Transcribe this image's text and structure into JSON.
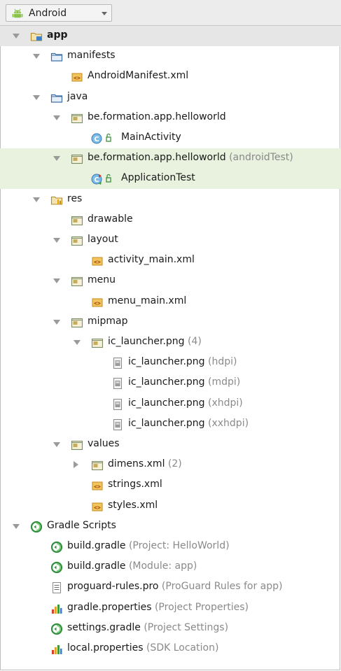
{
  "toolbar": {
    "view_selector": "Android"
  },
  "tree": [
    {
      "id": "app",
      "label": "app",
      "suffix": "",
      "bold": true,
      "icon": "module-folder-icon",
      "arrow": "down",
      "depth": 0
    },
    {
      "id": "manifests",
      "label": "manifests",
      "suffix": "",
      "icon": "folder-icon",
      "arrow": "down",
      "depth": 1
    },
    {
      "id": "androidmanifest",
      "label": "AndroidManifest.xml",
      "suffix": "",
      "icon": "xml-file-icon",
      "arrow": "",
      "depth": 2
    },
    {
      "id": "java",
      "label": "java",
      "suffix": "",
      "icon": "folder-icon",
      "arrow": "down",
      "depth": 1
    },
    {
      "id": "pkg-main",
      "label": "be.formation.app.helloworld",
      "suffix": "",
      "icon": "package-icon",
      "arrow": "down",
      "depth": 2
    },
    {
      "id": "mainactivity",
      "label": "MainActivity",
      "suffix": "",
      "icon": "class-icon",
      "arrow": "",
      "depth": 3
    },
    {
      "id": "pkg-test",
      "label": "be.formation.app.helloworld",
      "suffix": "(androidTest)",
      "icon": "package-icon",
      "arrow": "down",
      "depth": 2,
      "highlight": true
    },
    {
      "id": "applicationtest",
      "label": "ApplicationTest",
      "suffix": "",
      "icon": "test-class-icon",
      "arrow": "",
      "depth": 3,
      "highlight": true
    },
    {
      "id": "res",
      "label": "res",
      "suffix": "",
      "icon": "res-folder-icon",
      "arrow": "down",
      "depth": 1
    },
    {
      "id": "drawable",
      "label": "drawable",
      "suffix": "",
      "icon": "package-icon",
      "arrow": "",
      "depth": 2
    },
    {
      "id": "layout",
      "label": "layout",
      "suffix": "",
      "icon": "package-icon",
      "arrow": "down",
      "depth": 2
    },
    {
      "id": "activity-main",
      "label": "activity_main.xml",
      "suffix": "",
      "icon": "xml-file-icon",
      "arrow": "",
      "depth": 3
    },
    {
      "id": "menu",
      "label": "menu",
      "suffix": "",
      "icon": "package-icon",
      "arrow": "down",
      "depth": 2
    },
    {
      "id": "menu-main",
      "label": "menu_main.xml",
      "suffix": "",
      "icon": "xml-file-icon",
      "arrow": "",
      "depth": 3
    },
    {
      "id": "mipmap",
      "label": "mipmap",
      "suffix": "",
      "icon": "package-icon",
      "arrow": "down",
      "depth": 2
    },
    {
      "id": "ic-launcher",
      "label": "ic_launcher.png",
      "suffix": "(4)",
      "icon": "package-icon",
      "arrow": "down",
      "depth": 3
    },
    {
      "id": "ic-hdpi",
      "label": "ic_launcher.png",
      "suffix": "(hdpi)",
      "icon": "image-file-icon",
      "arrow": "",
      "depth": 4
    },
    {
      "id": "ic-mdpi",
      "label": "ic_launcher.png",
      "suffix": "(mdpi)",
      "icon": "image-file-icon",
      "arrow": "",
      "depth": 4
    },
    {
      "id": "ic-xhdpi",
      "label": "ic_launcher.png",
      "suffix": "(xhdpi)",
      "icon": "image-file-icon",
      "arrow": "",
      "depth": 4
    },
    {
      "id": "ic-xxhdpi",
      "label": "ic_launcher.png",
      "suffix": "(xxhdpi)",
      "icon": "image-file-icon",
      "arrow": "",
      "depth": 4
    },
    {
      "id": "values",
      "label": "values",
      "suffix": "",
      "icon": "package-icon",
      "arrow": "down",
      "depth": 2
    },
    {
      "id": "dimens",
      "label": "dimens.xml",
      "suffix": "(2)",
      "icon": "package-icon",
      "arrow": "right",
      "depth": 3
    },
    {
      "id": "strings",
      "label": "strings.xml",
      "suffix": "",
      "icon": "xml-file-icon",
      "arrow": "",
      "depth": 3
    },
    {
      "id": "styles",
      "label": "styles.xml",
      "suffix": "",
      "icon": "xml-file-icon",
      "arrow": "",
      "depth": 3
    },
    {
      "id": "gradle-scripts",
      "label": "Gradle Scripts",
      "suffix": "",
      "icon": "gradle-icon",
      "arrow": "down",
      "depth": 0
    },
    {
      "id": "build-project",
      "label": "build.gradle",
      "suffix": "(Project: HelloWorld)",
      "icon": "gradle-icon",
      "arrow": "",
      "depth": 1
    },
    {
      "id": "build-module",
      "label": "build.gradle",
      "suffix": "(Module: app)",
      "icon": "gradle-icon",
      "arrow": "",
      "depth": 1
    },
    {
      "id": "proguard",
      "label": "proguard-rules.pro",
      "suffix": "(ProGuard Rules for app)",
      "icon": "text-file-icon",
      "arrow": "",
      "depth": 1
    },
    {
      "id": "gradle-props",
      "label": "gradle.properties",
      "suffix": "(Project Properties)",
      "icon": "properties-icon",
      "arrow": "",
      "depth": 1
    },
    {
      "id": "settings-gradle",
      "label": "settings.gradle",
      "suffix": "(Project Settings)",
      "icon": "gradle-icon",
      "arrow": "",
      "depth": 1
    },
    {
      "id": "local-props",
      "label": "local.properties",
      "suffix": "(SDK Location)",
      "icon": "properties-icon",
      "arrow": "",
      "depth": 1
    }
  ]
}
